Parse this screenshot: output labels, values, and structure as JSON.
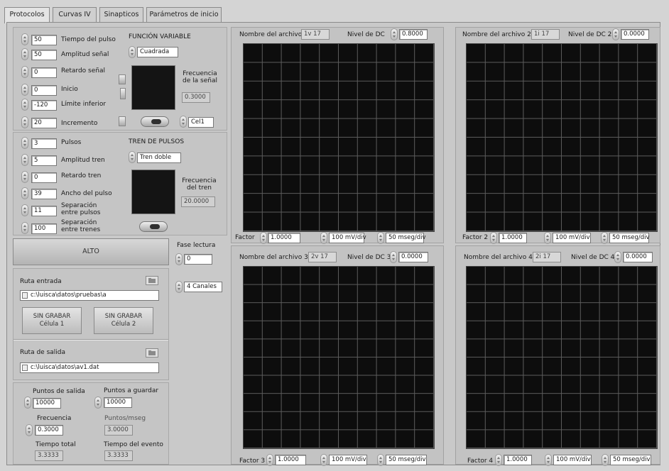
{
  "tabs": [
    "Protocolos",
    "Curvas IV",
    "Sinapticos",
    "Parámetros de inicio"
  ],
  "pulse": {
    "tiempo_label": "Tiempo del pulso",
    "tiempo": "50",
    "amplitud_label": "Amplitud señal",
    "amplitud": "50",
    "retardo_label": "Retardo señal",
    "retardo": "0",
    "inicio_label": "Inicio",
    "inicio": "0",
    "limite_label": "Límite inferior",
    "limite": "-120",
    "incremento_label": "Incremento",
    "incremento": "20",
    "funcion_title": "FUNCIÓN VARIABLE",
    "funcion": "Cuadrada",
    "frecuencia_label": "Frecuencia de la señal",
    "frecuencia": "0.3000",
    "celda": "Cel1"
  },
  "train": {
    "pulsos_label": "Pulsos",
    "pulsos": "3",
    "amplitud_label": "Amplitud tren",
    "amplitud": "5",
    "retardo_label": "Retardo tren",
    "retardo": "0",
    "ancho_label": "Ancho del pulso",
    "ancho": "39",
    "sep_pulsos_label": "Separación entre pulsos",
    "sep_pulsos": "11",
    "sep_trenes_label": "Separación entre trenes",
    "sep_trenes": "100",
    "title": "TREN DE PULSOS",
    "tipo": "Tren doble",
    "frecuencia_label": "Frecuencia del tren",
    "frecuencia": "20.0000"
  },
  "alto_label": "ALTO",
  "fase": {
    "label": "Fase lectura",
    "value": "0",
    "canales": "4 Canales"
  },
  "io": {
    "entrada_label": "Ruta entrada",
    "entrada": "c:\\luisca\\datos\\pruebas\\a",
    "sin1": "SIN GRABAR",
    "cel1": "Célula 1",
    "sin2": "SIN GRABAR",
    "cel2": "Célula 2",
    "salida_label": "Ruta de salida",
    "salida": "c:\\luisca\\datos\\av1.dat"
  },
  "points": {
    "salida_label": "Puntos de salida",
    "salida": "10000",
    "guardar_label": "Puntos a guardar",
    "guardar": "10000",
    "frecuencia_label": "Frecuencia",
    "frecuencia": "0.3000",
    "pms_label": "Puntos/mseg",
    "pms": "3.0000",
    "total_label": "Tiempo total",
    "total": "3.3333",
    "evento_label": "Tiempo del evento",
    "evento": "3.3333"
  },
  "graphs": [
    {
      "archivo_label": "Nombre del archivo",
      "archivo": "1v  17",
      "dc_label": "Nivel de DC",
      "dc": "0.8000",
      "factor_label": "Factor",
      "factor": "1.0000",
      "mv": "100 mV/div",
      "ms": "50 mseg/div"
    },
    {
      "archivo_label": "Nombre del archivo 2",
      "archivo": "1i  17",
      "dc_label": "Nivel de DC 2",
      "dc": "0.0000",
      "factor_label": "Factor 2",
      "factor": "1.0000",
      "mv": "100 mV/div",
      "ms": "50 mseg/div"
    },
    {
      "archivo_label": "Nombre del archivo 3",
      "archivo": "2v  17",
      "dc_label": "Nivel de DC 3",
      "dc": "0.0000",
      "factor_label": "Factor  3",
      "factor": "1.0000",
      "mv": "100 mV/div",
      "ms": "50 mseg/div"
    },
    {
      "archivo_label": "Nombre del archivo  4",
      "archivo": "2i  17",
      "dc_label": "Nivel de DC 4",
      "dc": "0.0000",
      "factor_label": "Factor  4",
      "factor": "1.0000",
      "mv": "100 mV/div",
      "ms": "50 mseg/div"
    }
  ]
}
